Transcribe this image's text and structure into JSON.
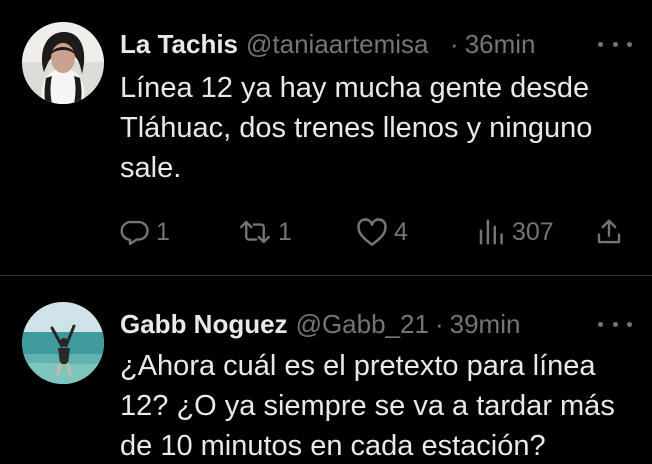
{
  "tweets": [
    {
      "display_name": "La Tachis",
      "handle": "@taniaartemisa",
      "separator": "·",
      "time": "36min",
      "text_lines": [
        "Línea 12 ya hay mucha gente desde",
        "Tláhuac, dos trenes llenos y ninguno",
        "sale."
      ],
      "actions": {
        "replies": "1",
        "retweets": "1",
        "likes": "4",
        "views": "307"
      }
    },
    {
      "display_name": "Gabb Noguez",
      "handle": "@Gabb_21",
      "separator": "·",
      "time": "39min",
      "text_lines": [
        "¿Ahora cuál es el pretexto para línea",
        "12? ¿O ya siempre se va a tardar más",
        "de 10 minutos en cada estación?"
      ]
    }
  ],
  "icons": {
    "more": "more-horizontal-icon",
    "reply": "reply-icon",
    "retweet": "retweet-icon",
    "like": "heart-icon",
    "views": "views-chart-icon",
    "share": "share-icon"
  },
  "colors": {
    "background": "#000000",
    "text_primary": "#e7e9ea",
    "text_secondary": "#71767b",
    "divider": "#2f3336"
  }
}
